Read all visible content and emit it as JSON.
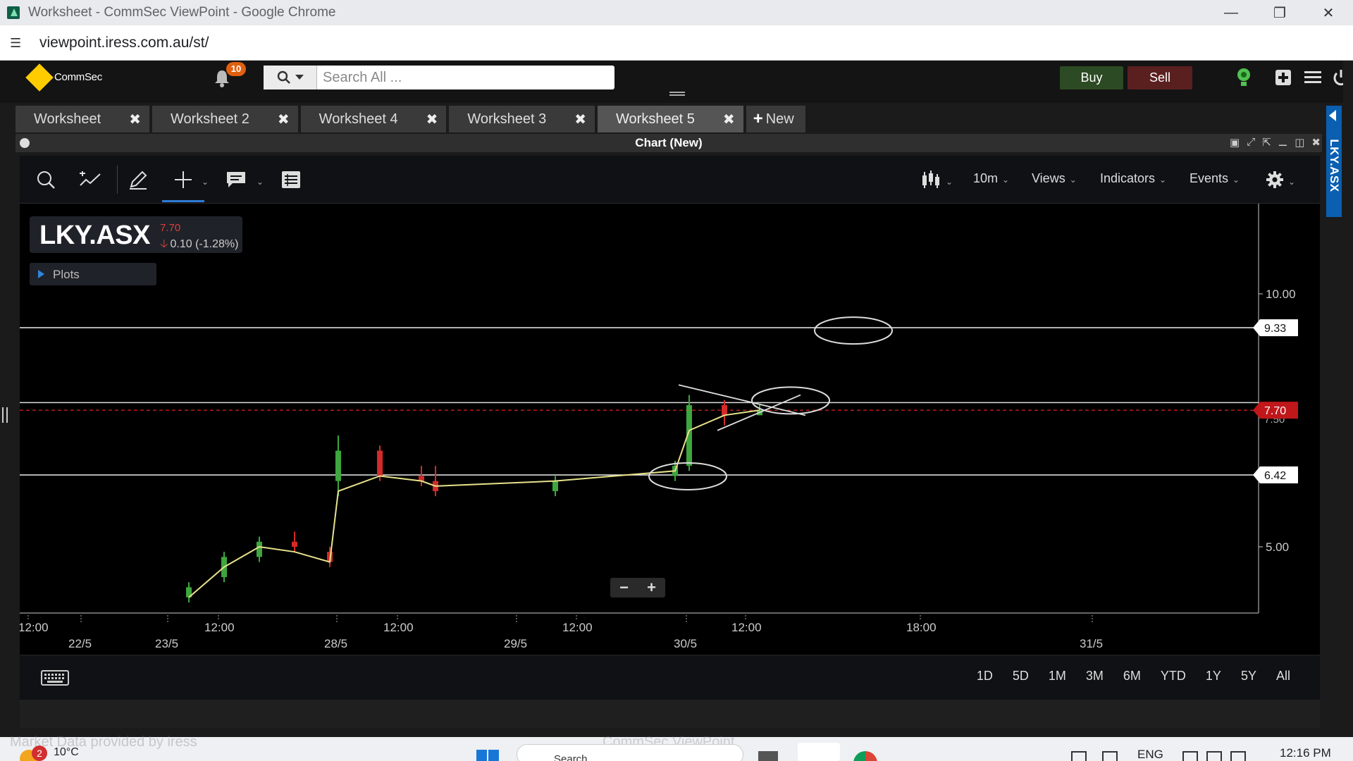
{
  "window": {
    "title": "Worksheet - CommSec ViewPoint - Google Chrome",
    "minimize_icon": "minimize-icon",
    "restore_icon": "restore-icon",
    "close_icon": "close-icon"
  },
  "addressbar": {
    "url": "viewpoint.iress.com.au/st/"
  },
  "header": {
    "logo_text": "CommSec",
    "notification_count": "10",
    "search_placeholder": "Search All ...",
    "buy_label": "Buy",
    "sell_label": "Sell"
  },
  "tabs": [
    {
      "label": "Worksheet",
      "active": false
    },
    {
      "label": "Worksheet 2",
      "active": false
    },
    {
      "label": "Worksheet 4",
      "active": false
    },
    {
      "label": "Worksheet 3",
      "active": false
    },
    {
      "label": "Worksheet 5",
      "active": true
    }
  ],
  "new_tab_label": "New",
  "panel": {
    "title": "Chart (New)"
  },
  "toolbar": {
    "interval": "10m",
    "views": "Views",
    "indicators": "Indicators",
    "events": "Events"
  },
  "symbol": {
    "name": "LKY.ASX",
    "price": "7.70",
    "change": "0.10 (-1.28%)",
    "plots_label": "Plots",
    "up_color": "#3ea63e",
    "down_color": "#d42a2a",
    "ma_color": "#e8e28c"
  },
  "side_tab_label": "LKY.ASX",
  "chart_data": {
    "type": "candlestick",
    "symbol": "LKY.ASX",
    "interval": "10m",
    "y_ticks": [
      10.0,
      5.0
    ],
    "y_tick_labels": [
      "10.00",
      "5.00"
    ],
    "horizontal_lines": [
      {
        "value": 9.33,
        "label": "9.33"
      },
      {
        "value": 7.85,
        "label": ""
      },
      {
        "value": 6.42,
        "label": "6.42"
      }
    ],
    "last_price": {
      "value": 7.7,
      "label": "7.70",
      "hidden_tick_label": "7.50"
    },
    "x_time_labels": [
      "12:00",
      "12:00",
      "12:00",
      "12:00",
      "12:00",
      "18:00"
    ],
    "x_date_labels": [
      "22/5",
      "23/5",
      "28/5",
      "29/5",
      "30/5",
      "31/5"
    ],
    "series": [
      {
        "name": "",
        "candles": [
          {
            "session": "23/5",
            "o": 4.0,
            "h": 4.3,
            "l": 3.9,
            "c": 4.2
          },
          {
            "session": "23/5",
            "o": 4.4,
            "h": 4.9,
            "l": 4.3,
            "c": 4.8
          },
          {
            "session": "23/5",
            "o": 4.8,
            "h": 5.2,
            "l": 4.7,
            "c": 5.1
          },
          {
            "session": "23/5",
            "o": 5.1,
            "h": 5.3,
            "l": 4.9,
            "c": 5.0
          },
          {
            "session": "23/5",
            "o": 4.9,
            "h": 5.0,
            "l": 4.6,
            "c": 4.7
          },
          {
            "session": "28/5",
            "o": 6.3,
            "h": 7.2,
            "l": 6.0,
            "c": 6.9
          },
          {
            "session": "28/5",
            "o": 6.9,
            "h": 7.0,
            "l": 6.3,
            "c": 6.4
          },
          {
            "session": "28/5",
            "o": 6.4,
            "h": 6.6,
            "l": 6.2,
            "c": 6.3
          },
          {
            "session": "29/5",
            "o": 6.3,
            "h": 6.6,
            "l": 6.0,
            "c": 6.1
          },
          {
            "session": "29/5",
            "o": 6.1,
            "h": 6.4,
            "l": 6.0,
            "c": 6.3
          },
          {
            "session": "29/5",
            "o": 6.4,
            "h": 6.7,
            "l": 6.3,
            "c": 6.6
          },
          {
            "session": "30/5",
            "o": 6.6,
            "h": 8.0,
            "l": 6.5,
            "c": 7.8
          },
          {
            "session": "30/5",
            "o": 7.8,
            "h": 7.9,
            "l": 7.4,
            "c": 7.6
          },
          {
            "session": "30/5",
            "o": 7.6,
            "h": 7.8,
            "l": 7.6,
            "c": 7.7
          }
        ]
      },
      {
        "name": "",
        "values": [
          4.0,
          4.6,
          5.0,
          4.9,
          4.7,
          6.1,
          6.4,
          6.3,
          6.2,
          6.3,
          6.5,
          7.3,
          7.6,
          7.7
        ]
      }
    ],
    "annotations": [
      "ellipse near 9.33",
      "ellipse near 7.85",
      "ellipse near 6.42",
      "converging trendlines at 30/5"
    ],
    "grid": false,
    "legend": "none"
  },
  "zoom": {
    "minus": "−",
    "plus": "+"
  },
  "ranges": [
    "1D",
    "5D",
    "1M",
    "3M",
    "6M",
    "YTD",
    "1Y",
    "5Y",
    "All"
  ],
  "taskbar": {
    "weather_count": "2",
    "temperature": "10°C",
    "search_label": "Search",
    "language": "ENG",
    "time": "12:16 PM",
    "credit_text": "Market Data provided by iress",
    "app_name": "CommSec ViewPoint"
  }
}
